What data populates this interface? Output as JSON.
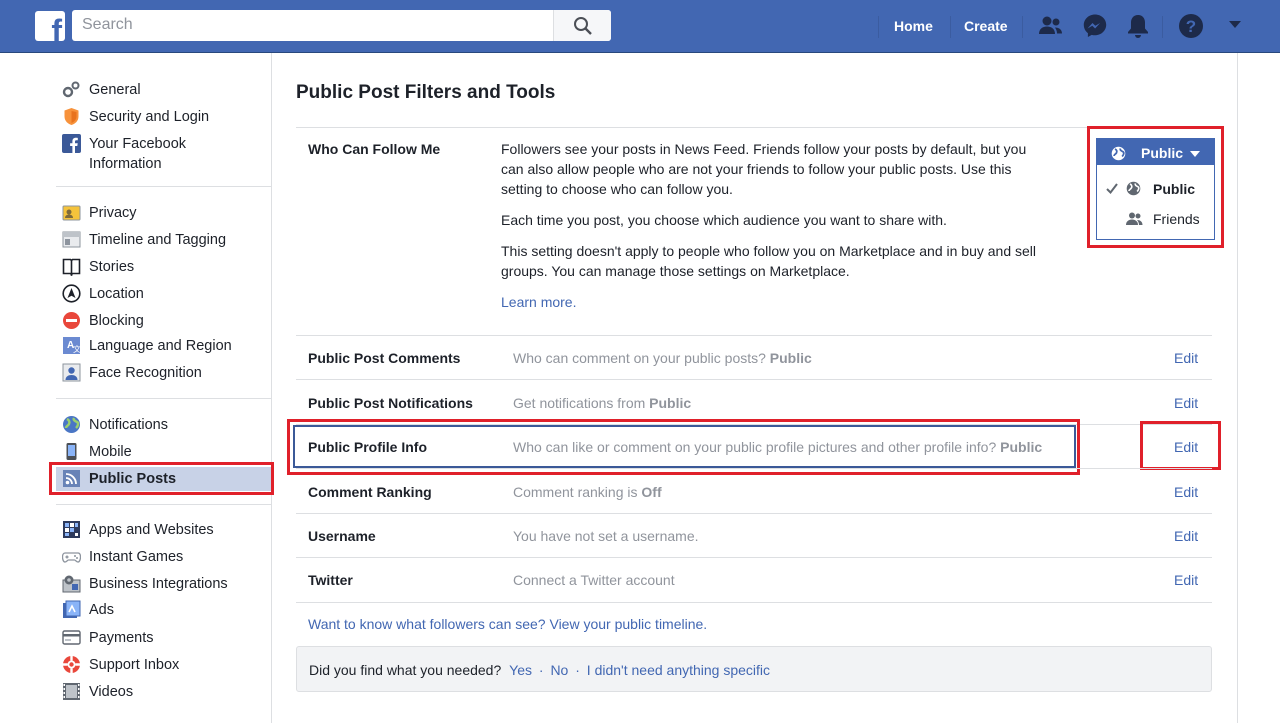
{
  "header": {
    "logo_letter": "f",
    "search_placeholder": "Search",
    "nav": {
      "home": "Home",
      "create": "Create"
    },
    "icons": [
      "friends-icon",
      "messenger-icon",
      "notifications-icon",
      "help-icon",
      "dropdown-arrow-icon"
    ],
    "brand_color": "#4267b2"
  },
  "sidebar": {
    "group1": [
      {
        "label": "General",
        "icon": "gear-icon"
      },
      {
        "label": "Security and Login",
        "icon": "shield-icon"
      },
      {
        "label": "Your Facebook Information",
        "label_line1": "Your Facebook",
        "label_line2": "Information",
        "icon": "facebook-icon"
      }
    ],
    "group2": [
      {
        "label": "Privacy",
        "icon": "privacy-icon"
      },
      {
        "label": "Timeline and Tagging",
        "icon": "timeline-icon"
      },
      {
        "label": "Stories",
        "icon": "stories-icon"
      },
      {
        "label": "Location",
        "icon": "location-icon"
      },
      {
        "label": "Blocking",
        "icon": "blocking-icon"
      },
      {
        "label": "Language and Region",
        "icon": "language-icon"
      },
      {
        "label": "Face Recognition",
        "icon": "face-recognition-icon"
      }
    ],
    "group3": [
      {
        "label": "Notifications",
        "icon": "globe-icon"
      },
      {
        "label": "Mobile",
        "icon": "mobile-icon"
      },
      {
        "label": "Public Posts",
        "icon": "rss-icon",
        "active": true
      }
    ],
    "group4": [
      {
        "label": "Apps and Websites",
        "icon": "apps-icon"
      },
      {
        "label": "Instant Games",
        "icon": "gamepad-icon"
      },
      {
        "label": "Business Integrations",
        "icon": "business-icon"
      },
      {
        "label": "Ads",
        "icon": "ads-icon"
      },
      {
        "label": "Payments",
        "icon": "payments-icon"
      },
      {
        "label": "Support Inbox",
        "icon": "support-icon"
      },
      {
        "label": "Videos",
        "icon": "videos-icon"
      }
    ]
  },
  "main": {
    "title": "Public Post Filters and Tools",
    "follow": {
      "label": "Who Can Follow Me",
      "para1": "Followers see your posts in News Feed. Friends follow your posts by default, but you can also allow people who are not your friends to follow your public posts. Use this setting to choose who can follow you.",
      "para2": "Each time you post, you choose which audience you want to share with.",
      "para3": "This setting doesn't apply to people who follow you on Marketplace and in buy and sell groups. You can manage those settings on Marketplace.",
      "learn_more": "Learn more.",
      "dropdown": {
        "selected": "Public",
        "options": [
          {
            "label": "Public",
            "checked": true,
            "icon": "globe-icon"
          },
          {
            "label": "Friends",
            "checked": false,
            "icon": "friends-icon"
          }
        ]
      }
    },
    "rows": [
      {
        "label": "Public Post Comments",
        "desc": "Who can comment on your public posts?",
        "value": "Public",
        "edit": "Edit"
      },
      {
        "label": "Public Post Notifications",
        "desc": "Get notifications from",
        "value": "Public",
        "edit": "Edit"
      },
      {
        "label": "Public Profile Info",
        "desc": "Who can like or comment on your public profile pictures and other profile info?",
        "value": "Public",
        "edit": "Edit"
      },
      {
        "label": "Comment Ranking",
        "desc": "Comment ranking is",
        "value": "Off",
        "edit": "Edit"
      },
      {
        "label": "Username",
        "desc": "You have not set a username.",
        "value": "",
        "edit": "Edit"
      },
      {
        "label": "Twitter",
        "desc": "Connect a Twitter account",
        "value": "",
        "edit": "Edit"
      }
    ],
    "timeline_link": "Want to know what followers can see? View your public timeline.",
    "feedback": {
      "question": "Did you find what you needed?",
      "yes": "Yes",
      "sep": "·",
      "no": "No",
      "none": "I didn't need anything specific"
    }
  },
  "annotation_color": "#e0202a"
}
